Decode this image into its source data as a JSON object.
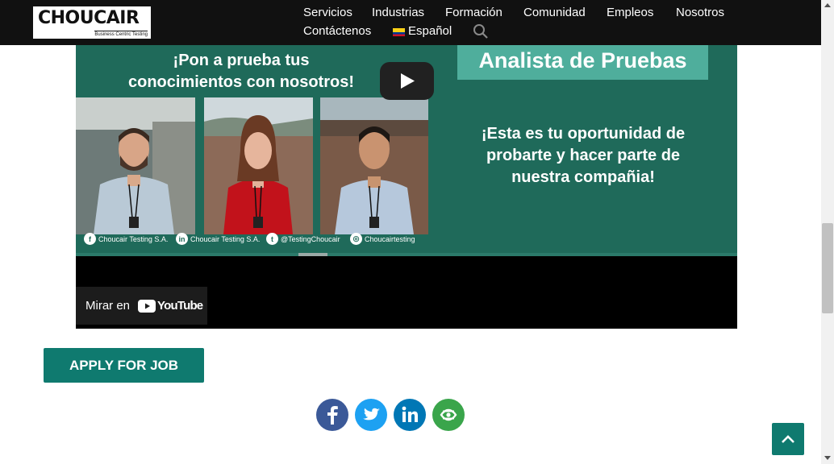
{
  "header": {
    "logo": {
      "name": "CHOUCAIR",
      "tagline": "Business Centric Testing"
    },
    "nav": [
      {
        "label": "Servicios"
      },
      {
        "label": "Industrias"
      },
      {
        "label": "Formación"
      },
      {
        "label": "Comunidad"
      },
      {
        "label": "Empleos"
      },
      {
        "label": "Nosotros"
      },
      {
        "label": "Contáctenos"
      }
    ],
    "language": {
      "label": "Español",
      "flag_icon": "colombia-flag-icon"
    },
    "search_icon": "search-icon"
  },
  "video": {
    "tagline_line1": "¡Pon a prueba tus",
    "tagline_line2": "conocimientos con nosotros!",
    "title": "Analista de Pruebas",
    "offer_line1": "¡Esta es tu oportunidad de",
    "offer_line2": "probarte y hacer parte de",
    "offer_line3": "nuestra compañia!",
    "social": [
      {
        "icon": "facebook-icon",
        "text": "Choucair Testing S.A."
      },
      {
        "icon": "linkedin-icon",
        "text": "Choucair Testing S.A."
      },
      {
        "icon": "twitter-icon",
        "text": "@TestingChoucair"
      },
      {
        "icon": "instagram-icon",
        "text": "Choucairtesting"
      }
    ],
    "progress": 0.33,
    "watch_on_label": "Mirar en",
    "youtube_word": "YouTube"
  },
  "apply_button_label": "APPLY FOR JOB",
  "share": [
    {
      "icon": "facebook-icon",
      "color": "#3b5998"
    },
    {
      "icon": "twitter-icon",
      "color": "#1da1f2"
    },
    {
      "icon": "linkedin-icon",
      "color": "#0077b5"
    },
    {
      "icon": "more-share-icon",
      "color": "#3aa54b"
    }
  ],
  "colors": {
    "accent": "#0f7a6f",
    "video_bg": "#1f6a5a",
    "title_box": "#4fae9c",
    "header_bg": "#111111"
  }
}
